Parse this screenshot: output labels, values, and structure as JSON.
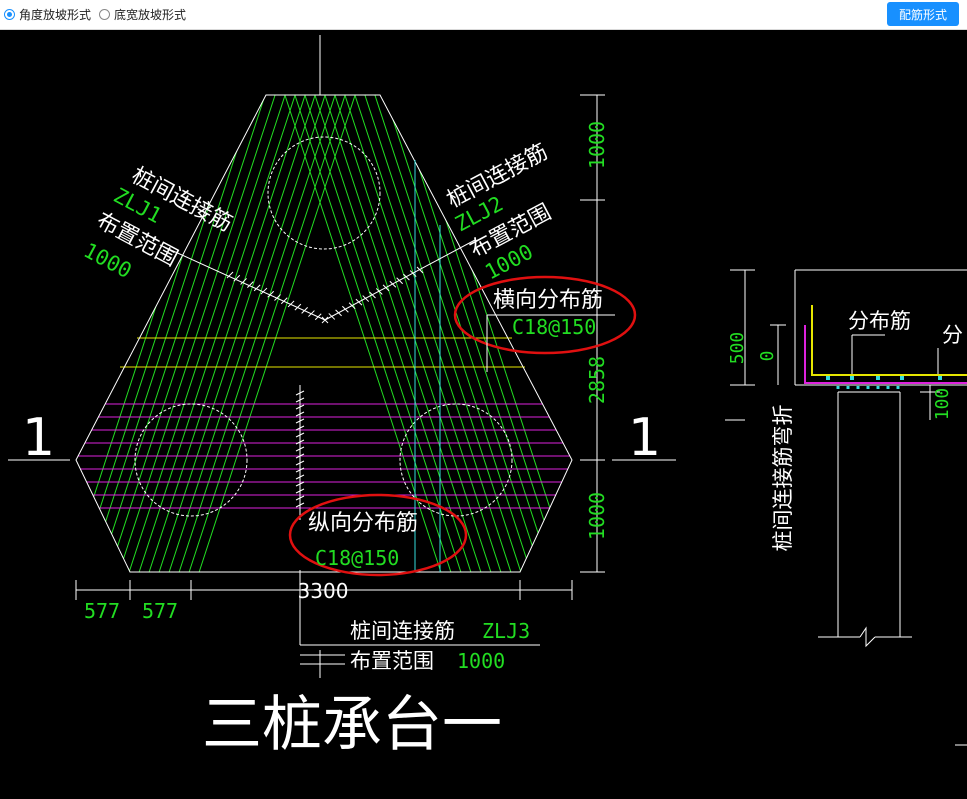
{
  "toolbar": {
    "radio_angle": "角度放坡形式",
    "radio_width": "底宽放坡形式",
    "angle_checked": true,
    "button_label": "配筋形式"
  },
  "drawing": {
    "title": "三桩承台一",
    "section_mark_left": "1",
    "section_mark_right": "1",
    "zlj1_name": "桩间连接筋",
    "zlj1_code": "ZLJ1",
    "zlj1_range_label": "布置范围",
    "zlj1_range_value": "1000",
    "zlj2_name": "桩间连接筋",
    "zlj2_code": "ZLJ2",
    "zlj2_range_label": "布置范围",
    "zlj2_range_value": "1000",
    "zlj3_name": "桩间连接筋",
    "zlj3_code": "ZLJ3",
    "zlj3_range_label": "布置范围",
    "zlj3_range_value": "1000",
    "transverse_label": "横向分布筋",
    "transverse_spec": "C18@150",
    "longitudinal_label": "纵向分布筋",
    "longitudinal_spec": "C18@150",
    "dim_top": "1000",
    "dim_mid": "2858",
    "dim_bottom": "1000",
    "dim_width": "3300",
    "dim_577_a": "577",
    "dim_577_b": "577"
  },
  "section": {
    "dim_500": "500",
    "dim_0": "0",
    "dim_100": "100",
    "dist_label": "分布筋",
    "dist_label_cut": "分",
    "vertical_label": "桩间连接筋弯折"
  }
}
